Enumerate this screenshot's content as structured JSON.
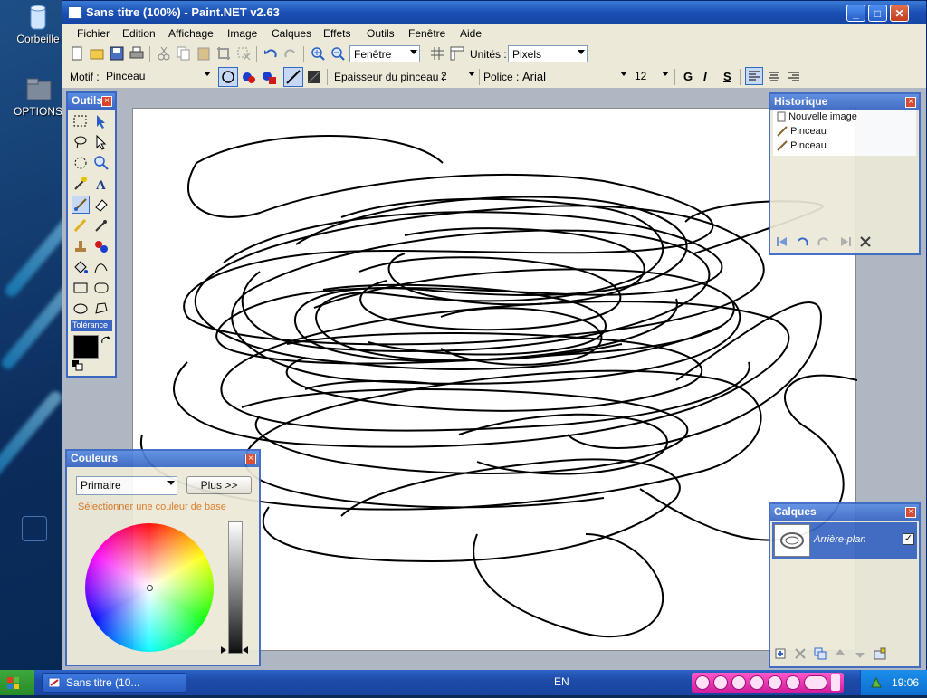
{
  "desktop": {
    "icons": [
      {
        "label": "Corbeille"
      },
      {
        "label": "OPTIONS"
      }
    ]
  },
  "window": {
    "title": "Sans titre (100%) - Paint.NET v2.63",
    "controls": {
      "minimize": "_",
      "maximize": "□",
      "close": "✕"
    }
  },
  "menu": {
    "items": [
      "Fichier",
      "Edition",
      "Affichage",
      "Image",
      "Calques",
      "Effets",
      "Outils",
      "Fenêtre",
      "Aide"
    ]
  },
  "toolbar1": {
    "zoom_mode": "Fenêtre",
    "units_label": "Unités :",
    "units_value": "Pixels"
  },
  "toolbar2": {
    "motif_label": "Motif :",
    "motif_value": "Pinceau",
    "brush_width_label": "Epaisseur du pinceau :",
    "brush_width_value": "2",
    "font_label": "Police :",
    "font_value": "Arial",
    "font_size": "12",
    "bold": "G",
    "italic": "I",
    "strike": "S"
  },
  "tools_panel": {
    "title": "Outils",
    "tolerance_label": "Tolérance"
  },
  "history_panel": {
    "title": "Historique",
    "items": [
      "Nouvelle image",
      "Pinceau",
      "Pinceau"
    ]
  },
  "colors_panel": {
    "title": "Couleurs",
    "mode_value": "Primaire",
    "more_button": "Plus >>",
    "hint": "Sélectionner une couleur de base"
  },
  "layers_panel": {
    "title": "Calques",
    "layers": [
      {
        "name": "Arrière-plan",
        "visible": true
      }
    ]
  },
  "taskbar": {
    "task_label": "Sans titre (10...",
    "language": "EN",
    "clock": "19:06"
  },
  "colors": {
    "titlebar": "#1b4fb5",
    "panel_border": "#3a67c2",
    "hint_text": "#d8731a",
    "canvas_bg": "#afb7c3"
  }
}
